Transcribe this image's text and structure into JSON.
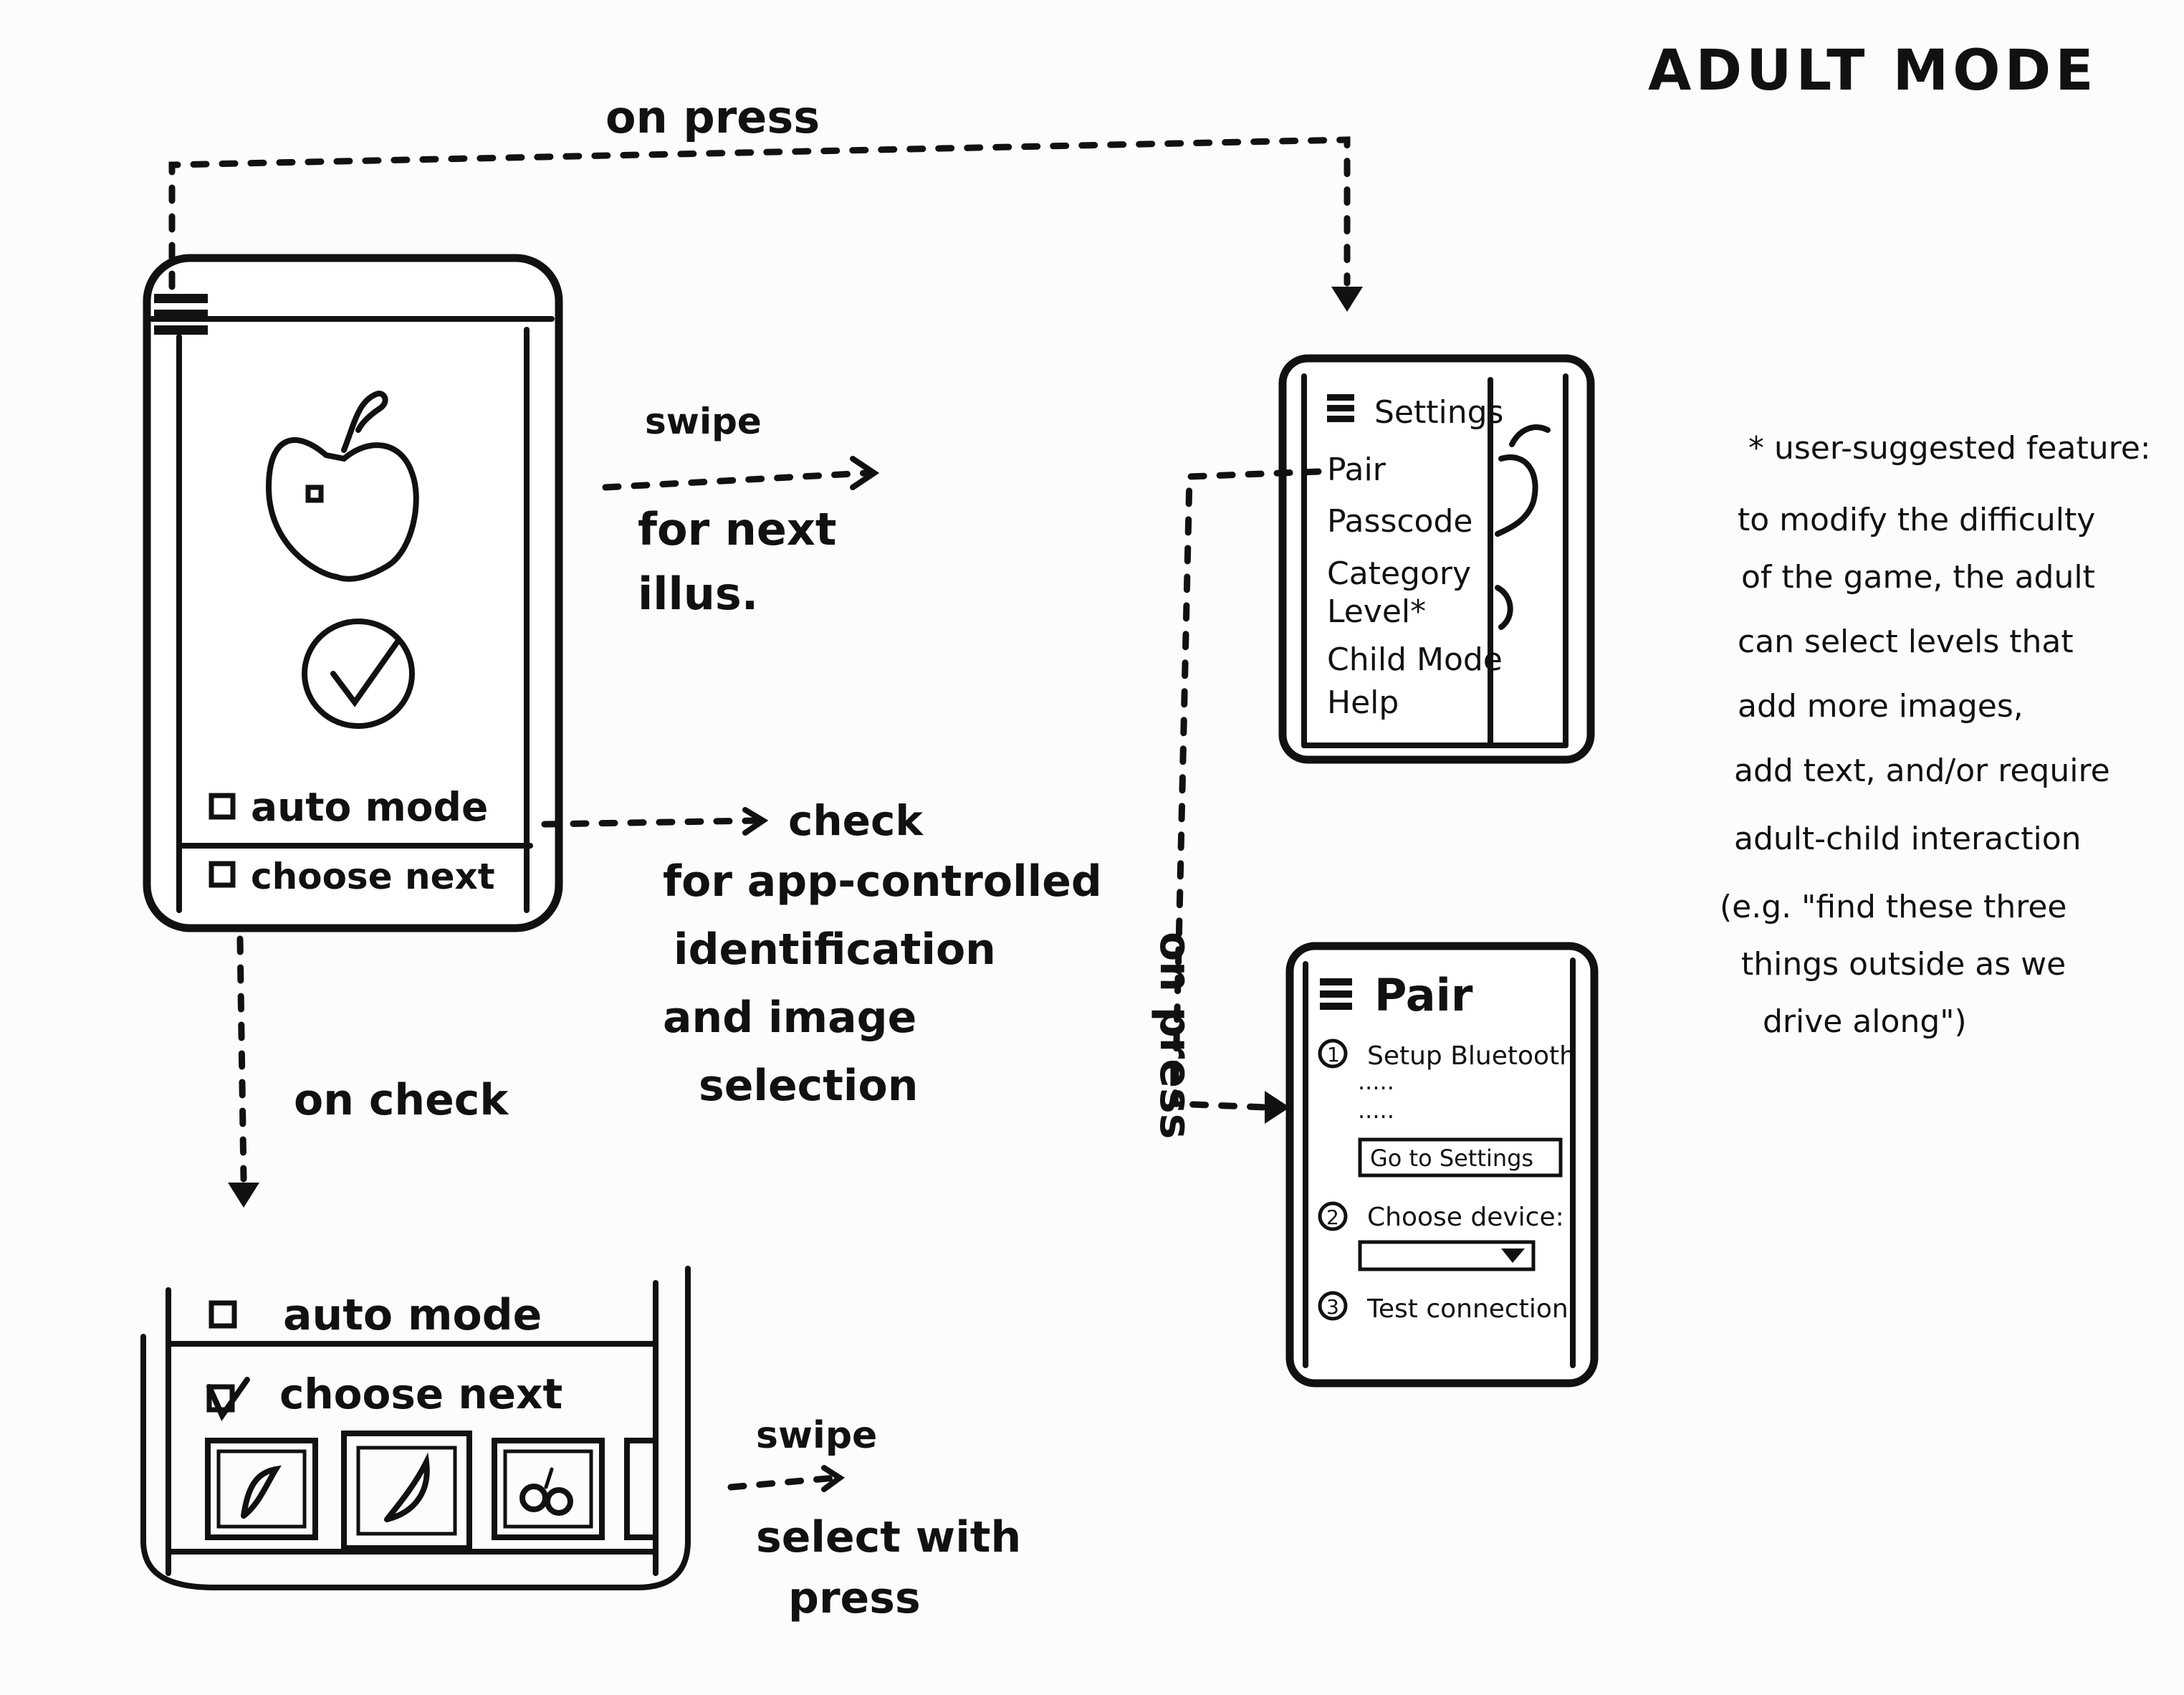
{
  "title": "ADULT MODE",
  "main_screen": {
    "auto_mode_label": "auto mode",
    "choose_next_label": "choose next"
  },
  "annotations": {
    "on_press_top": "on press",
    "swipe": "swipe",
    "for_next_illus": [
      "for next",
      "illus."
    ],
    "check": "check",
    "check_desc": [
      "for app-controlled",
      "identification",
      "and image",
      "selection"
    ],
    "on_check": "on check",
    "on_press_side": "on press",
    "swipe_bottom": "swipe",
    "select_with_press": [
      "select with",
      "press"
    ]
  },
  "menu_screen": {
    "title": "Settings",
    "items": [
      "Pair",
      "Passcode",
      "Category",
      "Level*",
      "Child Mode",
      "Help"
    ]
  },
  "pair_screen": {
    "title": "Pair",
    "step1": "Setup Bluetooth",
    "ellipsis1": ".....",
    "ellipsis2": ".....",
    "settings_button": "Go to Settings",
    "step2": "Choose device:",
    "step3": "Test connection",
    "num1": "1",
    "num2": "2",
    "num3": "3"
  },
  "bottom_panel": {
    "auto_mode_label": "auto mode",
    "choose_next_label": "choose next"
  },
  "note": {
    "lines": [
      "* user-suggested feature:",
      "to modify the difficulty",
      "of the game, the adult",
      "can select levels that",
      "add more images,",
      "add text, and/or require",
      "adult-child interaction",
      "(e.g. \"find these three",
      "things outside as we",
      "drive along\")"
    ]
  }
}
